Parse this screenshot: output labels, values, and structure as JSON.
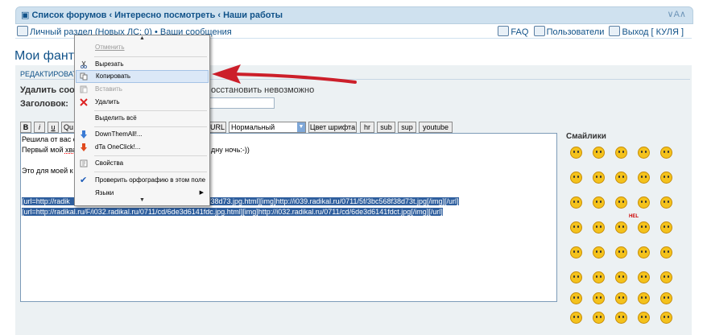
{
  "nav": {
    "crumbs": [
      "Список форумов",
      "Интересно посмотреть",
      "Наши работы"
    ],
    "toggle": "∨A∧"
  },
  "subnav": {
    "personal": "Личный раздел (Новых ЛС: 0)",
    "your_posts": "Ваши сообщения",
    "faq": "FAQ",
    "users": "Пользователи",
    "logout": "Выход [ КУЛЯ ]"
  },
  "page": {
    "title": "Мои фантаз"
  },
  "form": {
    "header": "РЕДАКТИРОВАТЬ С",
    "delete_label": "Удалить сообщ",
    "delete_text": "осстановить невозможно",
    "subject_label": "Заголовок:",
    "subject_value": ""
  },
  "toolbar": {
    "b": "B",
    "i": "i",
    "u": "u",
    "quote": "Qu",
    "url": "URL",
    "size": "Нормальный",
    "color": "Цвет шрифта",
    "hr": "hr",
    "sub": "sub",
    "sup": "sup",
    "youtube": "youtube"
  },
  "body": {
    "line1": "Решила от вас о",
    "line2a": "Первый мой ",
    "line2b": "хва",
    "line2c": "дну ночь:-))",
    "line3": "Это для моей к",
    "sel1a": "[url=http://radik",
    "sel1b": "f38d73.jpg.html][img]http://i039.radikal.ru/0711/5f/3bc568f38d73t.jpg[/img][/url]",
    "sel2": "[url=http://radikal.ru/F/i032.radikal.ru/0711/cd/6de3d6141fdc.jpg.html][img]http://i032.radikal.ru/0711/cd/6de3d6141fdct.jpg[/img][/url]"
  },
  "smileys": {
    "title": "Смайлики",
    "hel": "HEL"
  },
  "menu": {
    "up_arrow": "▲",
    "down_arrow": "▼",
    "items": [
      {
        "label": "Отменить",
        "enabled": false
      },
      {
        "label": "Вырезать",
        "enabled": true
      },
      {
        "label": "Копировать",
        "enabled": true
      },
      {
        "label": "Вставить",
        "enabled": false
      },
      {
        "label": "Удалить",
        "enabled": true
      },
      {
        "label": "Выделить всё",
        "enabled": true
      },
      {
        "label": "DownThemAll!...",
        "enabled": true
      },
      {
        "label": "dTa OneClick!...",
        "enabled": true
      },
      {
        "label": "Свойства",
        "enabled": true
      },
      {
        "label": "Проверить орфографию в этом поле",
        "enabled": true
      },
      {
        "label": "Языки",
        "enabled": true
      }
    ],
    "submenu_arrow": "▶"
  },
  "colors": {
    "accent": "#105289",
    "nav_bg": "#cfe1ef",
    "selection": "#2f5f9e",
    "arrow": "#cc1f2a",
    "menu_highlight": "#dbe8f7"
  }
}
